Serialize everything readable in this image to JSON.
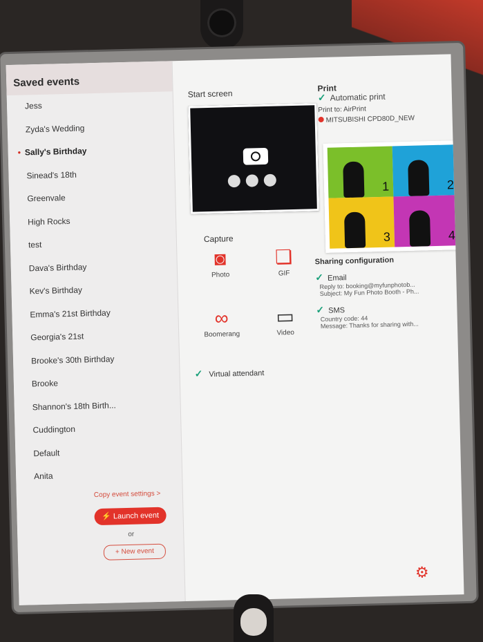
{
  "sidebar": {
    "title": "Saved events",
    "events": [
      "Jess",
      "Zyda's Wedding",
      "Sally's Birthday",
      "Sinead's 18th",
      "Greenvale",
      "High Rocks",
      "test",
      "Dava's Birthday",
      "Kev's Birthday",
      "Emma's 21st Birthday",
      "Georgia's 21st",
      "Brooke's 30th Birthday",
      "Brooke",
      "Shannon's 18th Birth...",
      "Cuddington",
      "Default",
      "Anita"
    ],
    "selected_index": 2,
    "copy_settings": "Copy event settings >",
    "launch": "⚡ Launch event",
    "or": "or",
    "new_event": "+ New event"
  },
  "start_screen": {
    "title": "Start screen"
  },
  "capture": {
    "title": "Capture",
    "items": [
      {
        "label": "Photo",
        "icon": "photo-icon"
      },
      {
        "label": "GIF",
        "icon": "gif-icon"
      },
      {
        "label": "Boomerang",
        "icon": "boomerang-icon"
      },
      {
        "label": "Video",
        "icon": "video-icon"
      }
    ],
    "virtual_attendant": "Virtual attendant"
  },
  "print": {
    "title": "Print",
    "automatic": "Automatic print",
    "print_to": "Print to: AirPrint",
    "printer": "MITSUBISHI CPD80D_NEW",
    "tile_colors": [
      "#7bbf2a",
      "#1fa2d8",
      "#f0c419",
      "#c336b4"
    ],
    "tile_numbers": [
      "1",
      "2",
      "3",
      "4"
    ]
  },
  "sharing": {
    "title": "Sharing configuration",
    "email": {
      "label": "Email",
      "reply": "Reply to: booking@myfunphotob...",
      "subject": "Subject: My Fun Photo Booth - Ph..."
    },
    "sms": {
      "label": "SMS",
      "country": "Country code: 44",
      "message": "Message: Thanks for sharing with..."
    }
  }
}
